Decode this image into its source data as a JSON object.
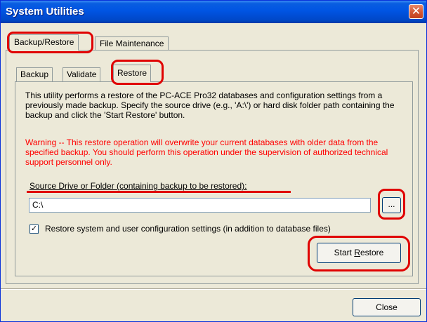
{
  "window": {
    "title": "System Utilities",
    "close_glyph": "✕"
  },
  "outer_tabs": [
    {
      "label": "Backup/Restore",
      "selected": true
    },
    {
      "label": "File Maintenance",
      "selected": false
    }
  ],
  "inner_tabs": [
    {
      "label": "Backup",
      "selected": false
    },
    {
      "label": "Validate",
      "selected": false
    },
    {
      "label": "Restore",
      "selected": true
    }
  ],
  "restore": {
    "description": "This utility performs a restore of the PC-ACE Pro32 databases and configuration settings from a previously made backup. Specify the source drive (e.g., 'A:\\') or hard disk folder path containing the backup and click the 'Start Restore' button.",
    "warning": "Warning -- This restore operation will overwrite your current databases with older data from the specified backup. You should perform this operation under the supervision of authorized technical support personnel only.",
    "source_label": "Source Drive or Folder (containing backup to be restored):",
    "source_value": "C:\\",
    "browse_label": "...",
    "checkbox_checked": true,
    "checkbox_mark": "✓",
    "checkbox_label": "Restore system and user configuration settings (in addition to database files)",
    "start_button_prefix": "Start ",
    "start_button_accel": "R",
    "start_button_rest": "estore"
  },
  "footer": {
    "close_label": "Close"
  },
  "colors": {
    "title_bar": "#0054e3",
    "warning_text": "#ff0000",
    "annotation": "#e00000",
    "dialog_bg": "#ece9d8"
  }
}
